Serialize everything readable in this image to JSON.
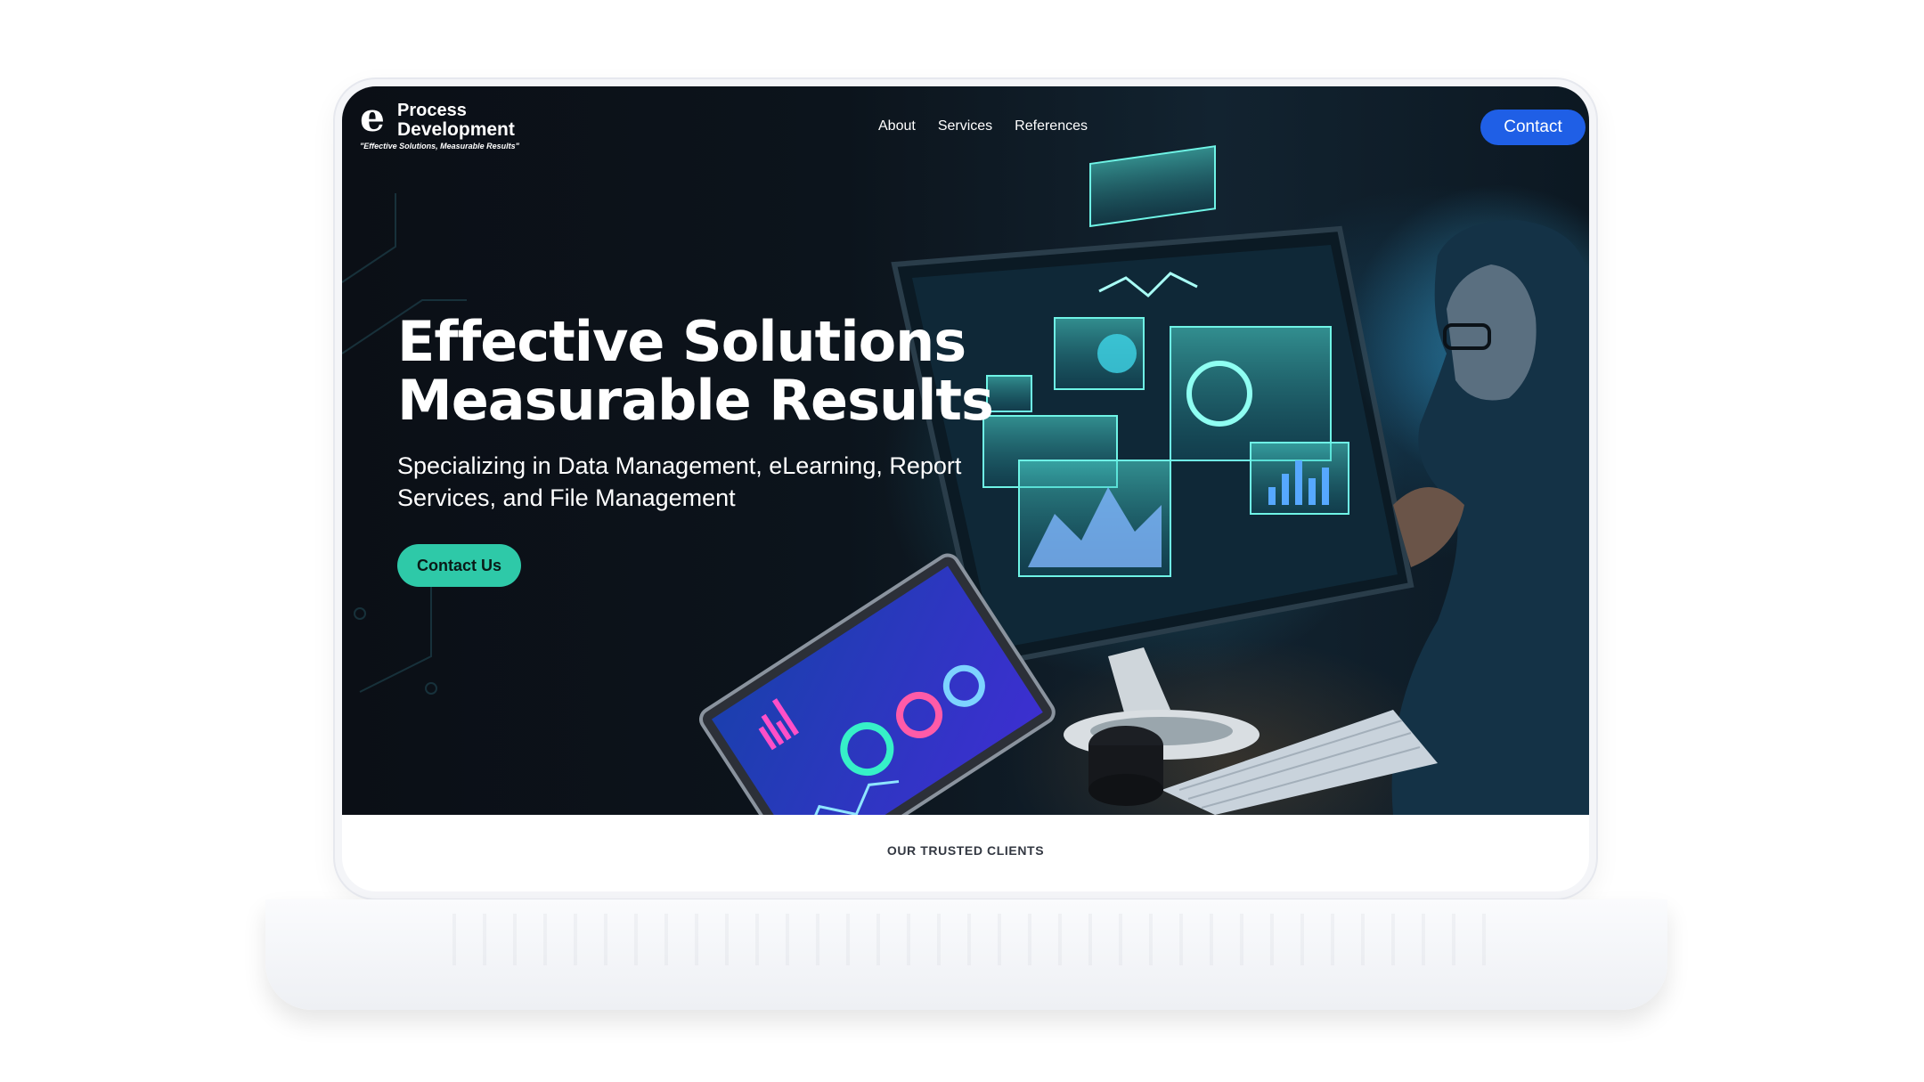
{
  "header": {
    "logo": {
      "mark": "e",
      "line1": "Process",
      "line2": "Development",
      "tagline": "\"Effective Solutions, Measurable Results\""
    },
    "nav": [
      {
        "label": "About"
      },
      {
        "label": "Services"
      },
      {
        "label": "References"
      }
    ],
    "contact_label": "Contact"
  },
  "hero": {
    "headline_line1": "Effective Solutions",
    "headline_line2": "Measurable Results",
    "subheadline": "Specializing in Data Management, eLearning, Report Services, and File Management",
    "cta_label": "Contact Us"
  },
  "clients": {
    "title": "OUR TRUSTED CLIENTS"
  },
  "colors": {
    "contact_button": "#1f5fe6",
    "cta_button": "#2ec9a8",
    "hero_background": "#0c141c"
  }
}
